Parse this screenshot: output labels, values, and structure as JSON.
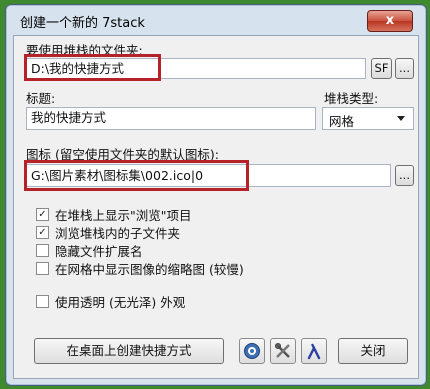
{
  "window": {
    "title": "创建一个新的 7stack",
    "close": "x"
  },
  "folder": {
    "label": "要使用堆栈的文件夹:",
    "value": "D:\\我的快捷方式",
    "sf_button": "SF",
    "browse_button": "..."
  },
  "title_field": {
    "label": "标题:",
    "value": "我的快捷方式"
  },
  "stack_type": {
    "label": "堆栈类型:",
    "selected": "网格"
  },
  "icon": {
    "label": "图标 (留空使用文件夹的默认图标):",
    "value": "G:\\图片素材\\图标集\\002.ico|0",
    "browse_button": "..."
  },
  "options": [
    {
      "label": "在堆栈上显示\"浏览\"项目",
      "checked": true
    },
    {
      "label": "浏览堆栈内的子文件夹",
      "checked": true
    },
    {
      "label": "隐藏文件扩展名",
      "checked": false
    },
    {
      "label": "在网格中显示图像的缩略图 (较慢)",
      "checked": false
    }
  ],
  "transparent": {
    "label": "使用透明 (无光泽) 外观",
    "checked": false
  },
  "footer": {
    "create_shortcut": "在桌面上创建快捷方式",
    "close": "关闭",
    "icons": [
      "help-icon",
      "settings-tools-icon",
      "about-lambda-icon"
    ]
  },
  "check_mark": "✓"
}
